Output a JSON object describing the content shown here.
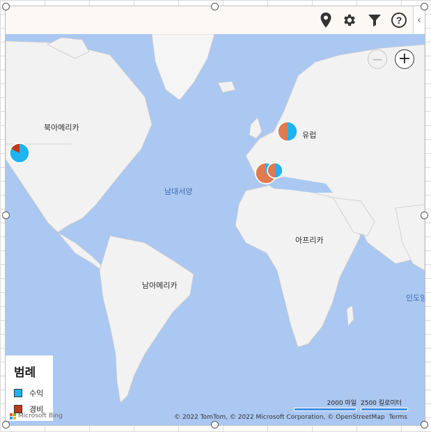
{
  "toolbar": {
    "icons": [
      "location-pin-icon",
      "gear-icon",
      "filter-icon",
      "help-icon"
    ],
    "collapse_label": "‹"
  },
  "map": {
    "labels": {
      "north_america": "북아메리카",
      "europe": "유럽",
      "atlantic": "남대서양",
      "africa": "아프리카",
      "south_america": "남아메리카",
      "indian": "인도양"
    },
    "zoom_out": "−",
    "zoom_in": "+"
  },
  "legend": {
    "title": "범례",
    "items": [
      {
        "label": "수익",
        "color": "#1fb3f0"
      },
      {
        "label": "경비",
        "color": "#c0391b"
      }
    ]
  },
  "pies": [
    {
      "name": "north-america-pie",
      "revenue_fraction": 0.85
    },
    {
      "name": "europe-west-pie",
      "revenue_fraction": 0.3
    },
    {
      "name": "europe-center-pie",
      "revenue_fraction": 0.5
    },
    {
      "name": "europe-north-pie",
      "revenue_fraction": 0.5
    }
  ],
  "scale": {
    "miles": "2000 마일",
    "km": "2500 킬로미터"
  },
  "attribution": {
    "brand": "Microsoft Bing",
    "text": "© 2022 TomTom, © 2022 Microsoft Corporation, © OpenStreetMap",
    "terms": "Terms"
  }
}
